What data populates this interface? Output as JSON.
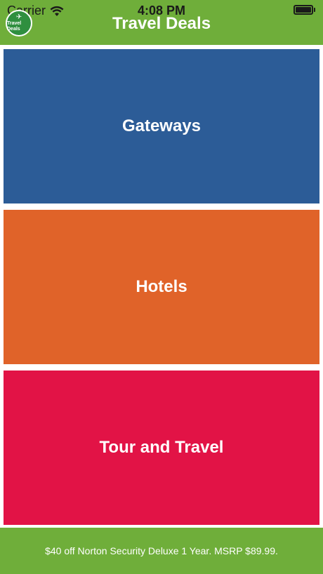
{
  "status_bar": {
    "carrier": "Carrier",
    "time": "4:08 PM",
    "battery_level": 1.0
  },
  "nav": {
    "title": "Travel Deals",
    "logo_text": "Travel Deals"
  },
  "tiles": [
    {
      "label": "Gateways",
      "color": "#2c5c97"
    },
    {
      "label": "Hotels",
      "color": "#e06329"
    },
    {
      "label": "Tour and Travel",
      "color": "#e21346"
    }
  ],
  "banner": {
    "text": "$40 off Norton Security Deluxe 1 Year. MSRP $89.99."
  },
  "theme": {
    "accent": "#6fae3a"
  }
}
